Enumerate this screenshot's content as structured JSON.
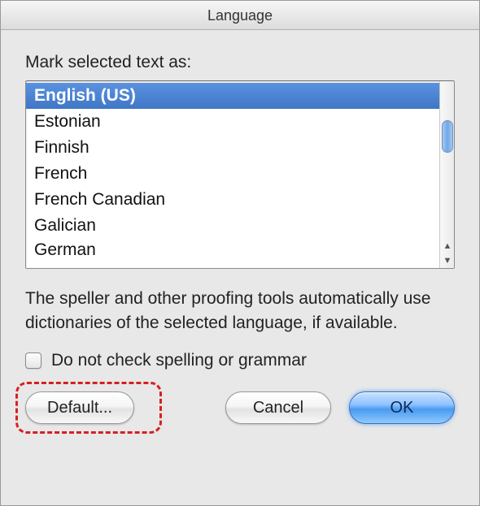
{
  "window": {
    "title": "Language"
  },
  "main": {
    "list_label": "Mark selected text as:",
    "languages": [
      "English (US)",
      "Estonian",
      "Finnish",
      "French",
      "French Canadian",
      "Galician",
      "German"
    ],
    "selected_index": 0,
    "description": "The speller and other proofing tools automatically use dictionaries of the selected language, if available.",
    "checkbox_label": "Do not check spelling or grammar",
    "checkbox_checked": false
  },
  "buttons": {
    "default": "Default...",
    "cancel": "Cancel",
    "ok": "OK"
  }
}
